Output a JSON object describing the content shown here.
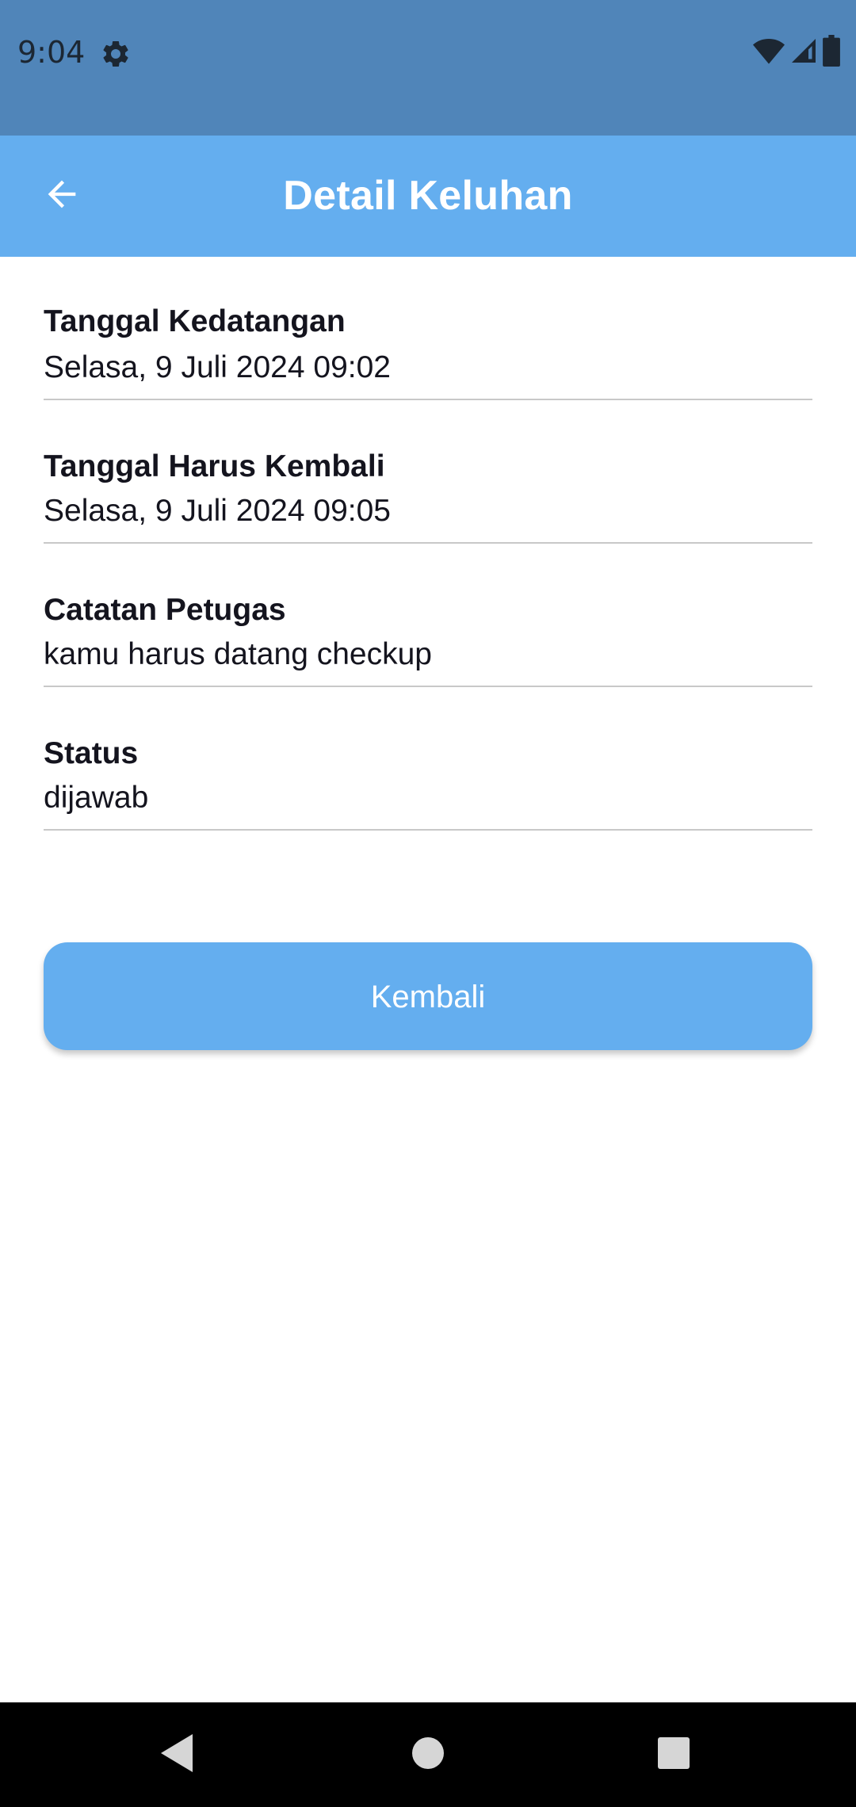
{
  "status_bar": {
    "time": "9:04",
    "icons": [
      "settings-gear-icon",
      "wifi-icon",
      "cell-signal-icon",
      "battery-icon"
    ]
  },
  "app_bar": {
    "title": "Detail Keluhan",
    "back_icon": "arrow-back-icon"
  },
  "details": [
    {
      "label": "Tanggal Kedatangan",
      "value": "Selasa, 9 Juli 2024 09:02"
    },
    {
      "label": "Tanggal Harus Kembali",
      "value": "Selasa, 9 Juli 2024 09:05"
    },
    {
      "label": "Catatan Petugas",
      "value": "kamu harus datang checkup"
    },
    {
      "label": "Status",
      "value": "dijawab"
    }
  ],
  "actions": {
    "back_button_label": "Kembali"
  },
  "nav_bar": {
    "icons": [
      "nav-back-icon",
      "nav-home-icon",
      "nav-recents-icon"
    ]
  },
  "colors": {
    "status_bar": "#5085b9",
    "app_bar": "#64aeef",
    "button": "#64aeef",
    "text": "#14141e",
    "divider": "#c8c8c8"
  }
}
